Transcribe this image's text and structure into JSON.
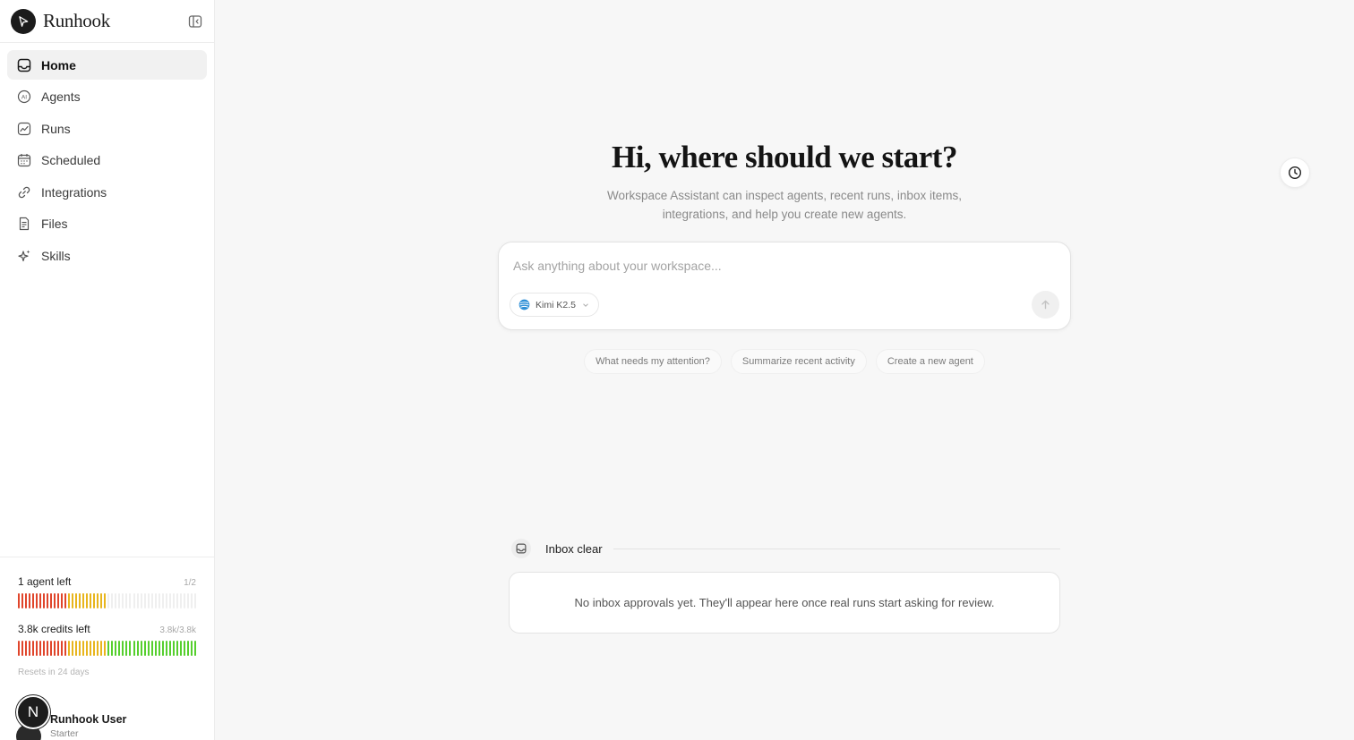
{
  "app": {
    "name": "Runhook",
    "logo_icon": "send-arrow-icon"
  },
  "sidebar": {
    "items": [
      {
        "label": "Home",
        "icon": "inbox-tray-icon",
        "active": true
      },
      {
        "label": "Agents",
        "icon": "ai-badge-icon",
        "active": false
      },
      {
        "label": "Runs",
        "icon": "line-chart-icon",
        "active": false
      },
      {
        "label": "Scheduled",
        "icon": "calendar-icon",
        "active": false
      },
      {
        "label": "Integrations",
        "icon": "link-icon",
        "active": false
      },
      {
        "label": "Files",
        "icon": "document-icon",
        "active": false
      },
      {
        "label": "Skills",
        "icon": "sparkle-icon",
        "active": false
      }
    ]
  },
  "usage": {
    "agents": {
      "label": "1 agent left",
      "count": "1/2",
      "used": 1,
      "total": 2
    },
    "credits": {
      "label": "3.8k credits left",
      "count": "3.8k/3.8k",
      "remaining_fraction": 1.0
    },
    "resets": "Resets in 24 days"
  },
  "user": {
    "initial": "N",
    "name": "Runhook User",
    "plan": "Starter"
  },
  "main": {
    "headline": "Hi, where should we start?",
    "subtext_line1": "Workspace Assistant can inspect agents, recent runs, inbox items,",
    "subtext_line2": "integrations, and help you create new agents.",
    "composer": {
      "placeholder": "Ask anything about your workspace...",
      "value": "",
      "model": "Kimi K2.5"
    },
    "suggestions": [
      "What needs my attention?",
      "Summarize recent activity",
      "Create a new agent"
    ],
    "inbox": {
      "title": "Inbox clear",
      "message": "No inbox approvals yet. They'll appear here once real runs start asking for review."
    }
  },
  "colors": {
    "red": "#e0452b",
    "yellow": "#e8b51c",
    "green": "#56cf2e",
    "empty": "#efefef"
  }
}
